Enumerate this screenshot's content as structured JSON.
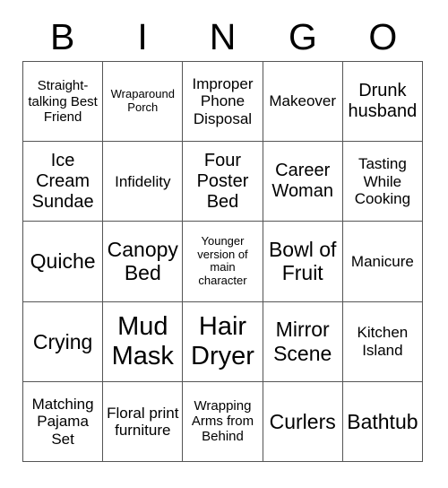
{
  "card": {
    "header_letters": [
      "B",
      "I",
      "N",
      "G",
      "O"
    ],
    "rows": [
      [
        {
          "text": "Straight-talking Best Friend",
          "size": "s"
        },
        {
          "text": "Wraparound Porch",
          "size": "xs"
        },
        {
          "text": "Improper Phone Disposal",
          "size": "m"
        },
        {
          "text": "Makeover",
          "size": "m"
        },
        {
          "text": "Drunk husband",
          "size": "l"
        }
      ],
      [
        {
          "text": "Ice Cream Sundae",
          "size": "l"
        },
        {
          "text": "Infidelity",
          "size": "m"
        },
        {
          "text": "Four Poster Bed",
          "size": "l"
        },
        {
          "text": "Career Woman",
          "size": "l"
        },
        {
          "text": "Tasting While Cooking",
          "size": "m"
        }
      ],
      [
        {
          "text": "Quiche",
          "size": "xl"
        },
        {
          "text": "Canopy Bed",
          "size": "xl"
        },
        {
          "text": "Younger version of main character",
          "size": "xs"
        },
        {
          "text": "Bowl of Fruit",
          "size": "xl"
        },
        {
          "text": "Manicure",
          "size": "m"
        }
      ],
      [
        {
          "text": "Crying",
          "size": "xl"
        },
        {
          "text": "Mud Mask",
          "size": "xxl"
        },
        {
          "text": "Hair Dryer",
          "size": "xxl"
        },
        {
          "text": "Mirror Scene",
          "size": "xl"
        },
        {
          "text": "Kitchen Island",
          "size": "m"
        }
      ],
      [
        {
          "text": "Matching Pajama Set",
          "size": "m"
        },
        {
          "text": "Floral print furniture",
          "size": "m"
        },
        {
          "text": "Wrapping Arms from Behind",
          "size": "s"
        },
        {
          "text": "Curlers",
          "size": "xl"
        },
        {
          "text": "Bathtub",
          "size": "xl"
        }
      ]
    ],
    "colors": {
      "background": "#ffffff",
      "text": "#000000",
      "grid_line": "#555555"
    }
  }
}
